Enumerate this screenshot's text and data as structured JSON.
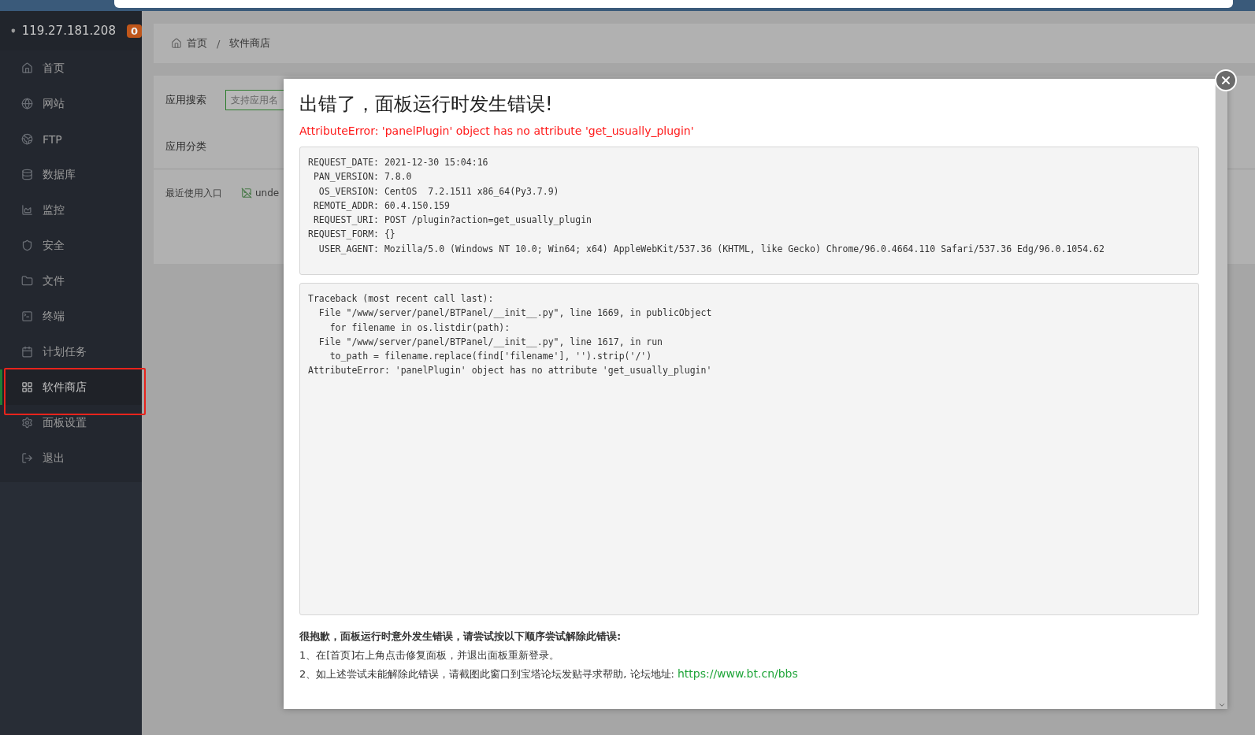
{
  "server": {
    "ip": "119.27.181.208",
    "badge": "0"
  },
  "sidebar": {
    "items": [
      {
        "label": "首页",
        "selected": false
      },
      {
        "label": "网站",
        "selected": false
      },
      {
        "label": "FTP",
        "selected": false
      },
      {
        "label": "数据库",
        "selected": false
      },
      {
        "label": "监控",
        "selected": false
      },
      {
        "label": "安全",
        "selected": false
      },
      {
        "label": "文件",
        "selected": false
      },
      {
        "label": "终端",
        "selected": false
      },
      {
        "label": "计划任务",
        "selected": false
      },
      {
        "label": "软件商店",
        "selected": true
      },
      {
        "label": "面板设置",
        "selected": false
      },
      {
        "label": "退出",
        "selected": false
      }
    ]
  },
  "breadcrumb": {
    "items": [
      "首页",
      "软件商店"
    ],
    "separator": "/"
  },
  "search": {
    "label": "应用搜索",
    "placeholder": "支持应用名"
  },
  "category_label": "应用分类",
  "recent": {
    "label": "最近使用入口",
    "item": "unde"
  },
  "dialog": {
    "title": "出错了，面板运行时发生错误!",
    "error": "AttributeError: 'panelPlugin' object has no attribute 'get_usually_plugin'",
    "info_lines": [
      "REQUEST_DATE: 2021-12-30 15:04:16",
      " PAN_VERSION: 7.8.0",
      "  OS_VERSION: CentOS  7.2.1511 x86_64(Py3.7.9)",
      " REMOTE_ADDR: 60.4.150.159",
      " REQUEST_URI: POST /plugin?action=get_usually_plugin",
      "REQUEST_FORM: {}",
      "  USER_AGENT: Mozilla/5.0 (Windows NT 10.0; Win64; x64) AppleWebKit/537.36 (KHTML, like Gecko) Chrome/96.0.4664.110 Safari/537.36 Edg/96.0.1054.62"
    ],
    "traceback": [
      "Traceback (most recent call last):",
      "  File \"/www/server/panel/BTPanel/__init__.py\", line 1669, in publicObject",
      "    for filename in os.listdir(path):",
      "  File \"/www/server/panel/BTPanel/__init__.py\", line 1617, in run",
      "    to_path = filename.replace(find['filename'], '').strip('/')",
      "AttributeError: 'panelPlugin' object has no attribute 'get_usually_plugin'"
    ],
    "help_title": "很抱歉，面板运行时意外发生错误，请尝试按以下顺序尝试解除此错误:",
    "help_lines": [
      "1、在[首页]右上角点击修复面板，并退出面板重新登录。",
      "2、如上述尝试未能解除此错误，请截图此窗口到宝塔论坛发贴寻求帮助, 论坛地址:"
    ],
    "link": "https://www.bt.cn/bbs"
  }
}
